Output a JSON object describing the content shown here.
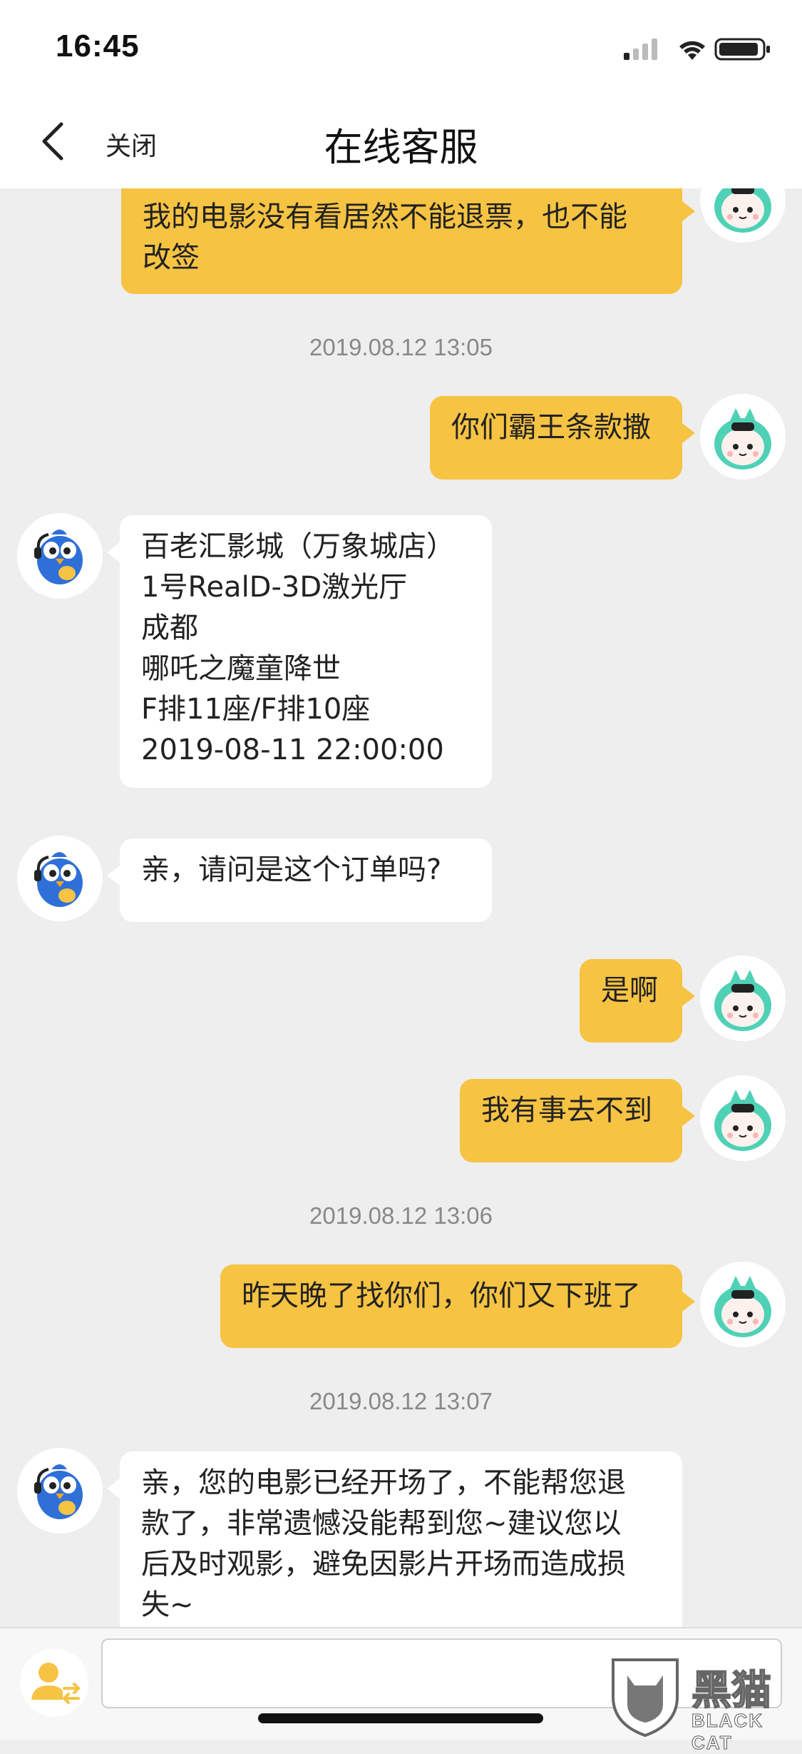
{
  "status_bar": {
    "time": "16:45"
  },
  "nav": {
    "close_label": "关闭",
    "title": "在线客服"
  },
  "messages": [
    {
      "from": "user",
      "lines": [
        "我的电影没有看居然不能退票，也不能",
        "改签"
      ]
    },
    {
      "timestamp": "2019.08.12 13:05"
    },
    {
      "from": "user",
      "lines": [
        "你们霸王条款撒"
      ]
    },
    {
      "from": "agent",
      "lines": [
        "百老汇影城（万象城店）",
        "1号RealD-3D激光厅",
        "成都",
        "哪吒之魔童降世",
        "F排11座/F排10座",
        "2019-08-11 22:00:00"
      ]
    },
    {
      "from": "agent",
      "lines": [
        "亲，请问是这个订单吗?"
      ]
    },
    {
      "from": "user",
      "lines": [
        "是啊"
      ]
    },
    {
      "from": "user",
      "lines": [
        "我有事去不到"
      ]
    },
    {
      "timestamp": "2019.08.12 13:06"
    },
    {
      "from": "user",
      "lines": [
        "昨天晚了找你们，你们又下班了"
      ]
    },
    {
      "timestamp": "2019.08.12 13:07"
    },
    {
      "from": "agent",
      "lines": [
        "亲，您的电影已经开场了，不能帮您退",
        "款了，非常遗憾没能帮到您~建议您以",
        "后及时观影，避免因影片开场而造成损",
        "失~"
      ]
    }
  ],
  "input": {
    "placeholder": ""
  },
  "watermark": {
    "text": "黑猫",
    "sub": "BLACK CAT"
  },
  "colors": {
    "user_bubble": "#f6c343",
    "agent_bubble": "#ffffff",
    "background": "#eeeeee",
    "avatar_user_accent": "#4fd1b5",
    "avatar_agent_accent": "#2f6fd8"
  }
}
